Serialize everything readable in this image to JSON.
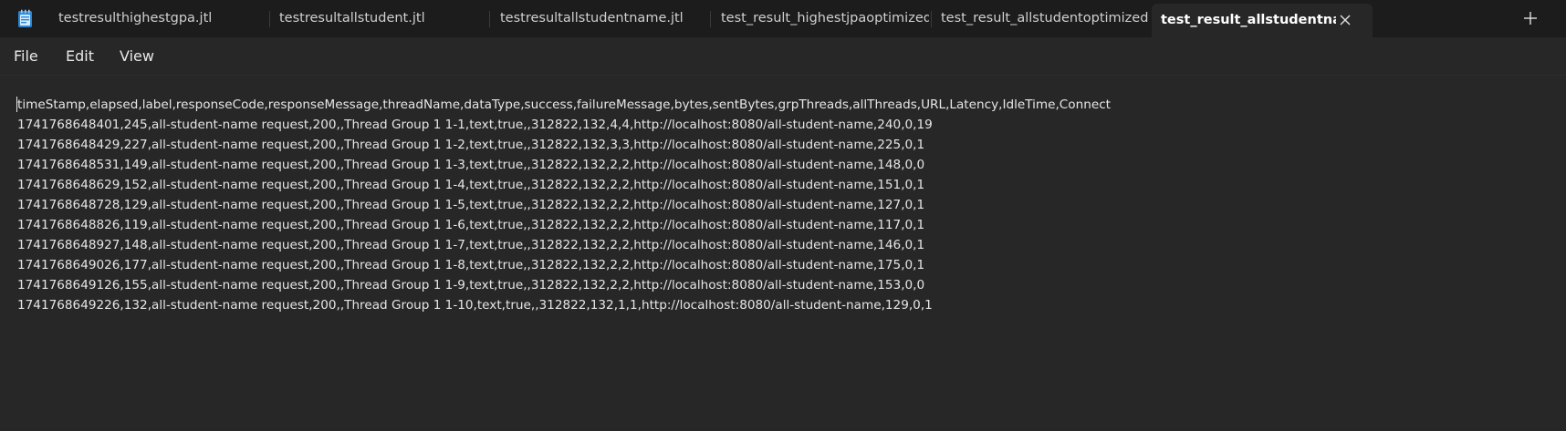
{
  "tabs": [
    {
      "label": "testresulthighestgpa.jtl",
      "active": false
    },
    {
      "label": "testresultallstudent.jtl",
      "active": false
    },
    {
      "label": "testresultallstudentname.jtl",
      "active": false
    },
    {
      "label": "test_result_highestjpaoptimized.jtl",
      "active": false
    },
    {
      "label": "test_result_allstudentoptimized.jtl",
      "active": false
    },
    {
      "label": "test_result_allstudentnameop",
      "active": true
    }
  ],
  "icons": {
    "app": "notepad-icon",
    "close": "close-icon",
    "new_tab": "plus-icon"
  },
  "menu": {
    "file": "File",
    "edit": "Edit",
    "view": "View"
  },
  "editor": {
    "lines": [
      "timeStamp,elapsed,label,responseCode,responseMessage,threadName,dataType,success,failureMessage,bytes,sentBytes,grpThreads,allThreads,URL,Latency,IdleTime,Connect",
      "1741768648401,245,all-student-name request,200,,Thread Group 1 1-1,text,true,,312822,132,4,4,http://localhost:8080/all-student-name,240,0,19",
      "1741768648429,227,all-student-name request,200,,Thread Group 1 1-2,text,true,,312822,132,3,3,http://localhost:8080/all-student-name,225,0,1",
      "1741768648531,149,all-student-name request,200,,Thread Group 1 1-3,text,true,,312822,132,2,2,http://localhost:8080/all-student-name,148,0,0",
      "1741768648629,152,all-student-name request,200,,Thread Group 1 1-4,text,true,,312822,132,2,2,http://localhost:8080/all-student-name,151,0,1",
      "1741768648728,129,all-student-name request,200,,Thread Group 1 1-5,text,true,,312822,132,2,2,http://localhost:8080/all-student-name,127,0,1",
      "1741768648826,119,all-student-name request,200,,Thread Group 1 1-6,text,true,,312822,132,2,2,http://localhost:8080/all-student-name,117,0,1",
      "1741768648927,148,all-student-name request,200,,Thread Group 1 1-7,text,true,,312822,132,2,2,http://localhost:8080/all-student-name,146,0,1",
      "1741768649026,177,all-student-name request,200,,Thread Group 1 1-8,text,true,,312822,132,2,2,http://localhost:8080/all-student-name,175,0,1",
      "1741768649126,155,all-student-name request,200,,Thread Group 1 1-9,text,true,,312822,132,2,2,http://localhost:8080/all-student-name,153,0,0",
      "1741768649226,132,all-student-name request,200,,Thread Group 1 1-10,text,true,,312822,132,1,1,http://localhost:8080/all-student-name,129,0,1"
    ]
  },
  "colors": {
    "tabbar_bg": "#1c1c1c",
    "editor_bg": "#272727",
    "text": "#e6e6e6",
    "notepad_blue": "#2b88d8"
  }
}
